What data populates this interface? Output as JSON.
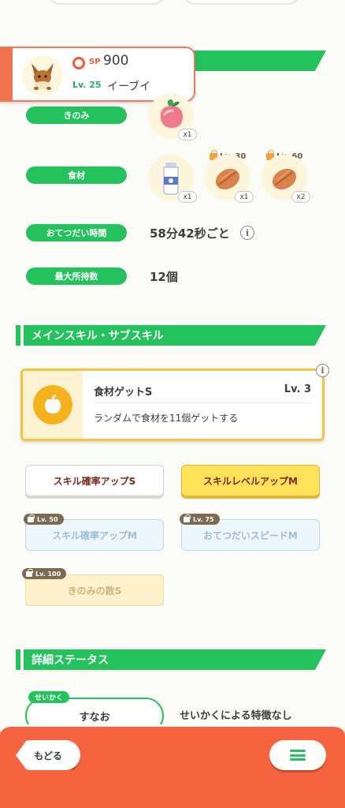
{
  "pokemon": {
    "sp_label": "SP",
    "sp_value": "900",
    "level_label": "Lv. 25",
    "name": "イーブイ"
  },
  "rows": {
    "berry": {
      "label": "きのみ",
      "qty": "x1"
    },
    "ingredients": {
      "label": "食材",
      "items": [
        {
          "qty": "x1",
          "lock_level": ""
        },
        {
          "qty": "x1",
          "lock_level": "Lv. 30"
        },
        {
          "qty": "x2",
          "lock_level": "Lv. 60"
        }
      ]
    },
    "help_time": {
      "label": "おてつだい時間",
      "value": "58分42秒ごと",
      "info": "i"
    },
    "max_carry": {
      "label": "最大所持数",
      "value": "12個"
    }
  },
  "skills_section": {
    "title": "メインスキル・サブスキル",
    "main_skill": {
      "name": "食材ゲットS",
      "level": "Lv. 3",
      "description": "ランダムで食材を11個ゲットする",
      "info": "i"
    },
    "sub_skills": [
      {
        "label": "スキル確率アップS",
        "lock": ""
      },
      {
        "label": "スキルレベルアップM",
        "lock": ""
      },
      {
        "label": "スキル確率アップM",
        "lock": "Lv. 50"
      },
      {
        "label": "おてつだいスピードM",
        "lock": "Lv. 75"
      },
      {
        "label": "きのみの数S",
        "lock": "Lv. 100"
      }
    ]
  },
  "details_section": {
    "title": "詳細ステータス",
    "nature_tag": "せいかく",
    "nature_value": "すなお",
    "nature_desc": "せいかくによる特徴なし"
  },
  "footer": {
    "back_label": "もどる"
  },
  "colors": {
    "green": "#23c25c",
    "orange": "#f6643f",
    "gold": "#f5c542"
  }
}
